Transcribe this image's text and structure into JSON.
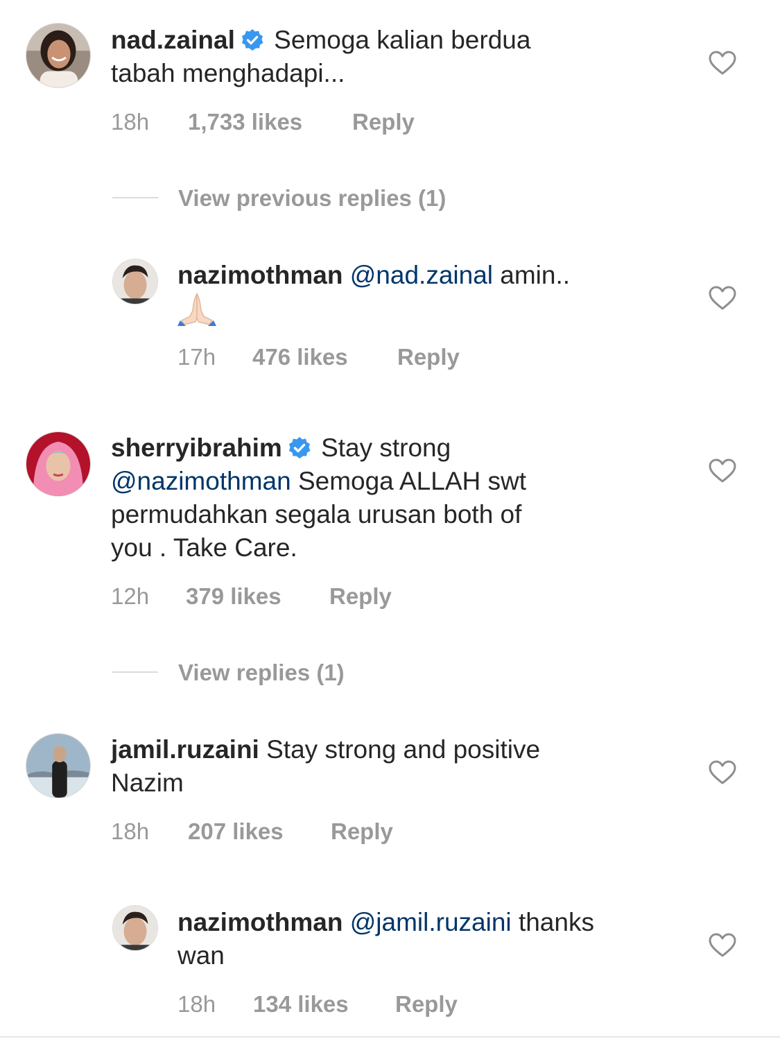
{
  "comments": [
    {
      "username": "nad.zainal",
      "verified": true,
      "text": "Semoga kalian berdua tabah menghadapi...",
      "line1": "Semoga kalian berdua",
      "line2": "tabah menghadapi...",
      "time": "18h",
      "likes": "1,733 likes",
      "reply_label": "Reply",
      "view_replies": "View previous replies (1)"
    },
    {
      "username": "nazimothman",
      "mention": "@nad.zainal",
      "text": "amin..",
      "emoji": "folded-hands",
      "time": "17h",
      "likes": "476 likes",
      "reply_label": "Reply"
    },
    {
      "username": "sherryibrahim",
      "verified": true,
      "line1": "Stay strong",
      "mention": "@nazimothman",
      "line2_rest": "Semoga ALLAH swt",
      "line3": "permudahkan segala urusan both of",
      "line4": "you . Take Care.",
      "time": "12h",
      "likes": "379 likes",
      "reply_label": "Reply",
      "view_replies": "View replies (1)"
    },
    {
      "username": "jamil.ruzaini",
      "line1": "Stay strong and positive",
      "line2": "Nazim",
      "time": "18h",
      "likes": "207 likes",
      "reply_label": "Reply"
    },
    {
      "username": "nazimothman",
      "mention": "@jamil.ruzaini",
      "line1_rest": "thanks",
      "line2": "wan",
      "time": "18h",
      "likes": "134 likes",
      "reply_label": "Reply"
    }
  ],
  "colors": {
    "text": "#262626",
    "meta": "#999999",
    "mention": "#003569",
    "verified": "#3897f0",
    "divider": "#dbdbdb"
  },
  "icons": {
    "like": "heart-outline-icon",
    "verified": "verified-badge-icon"
  }
}
